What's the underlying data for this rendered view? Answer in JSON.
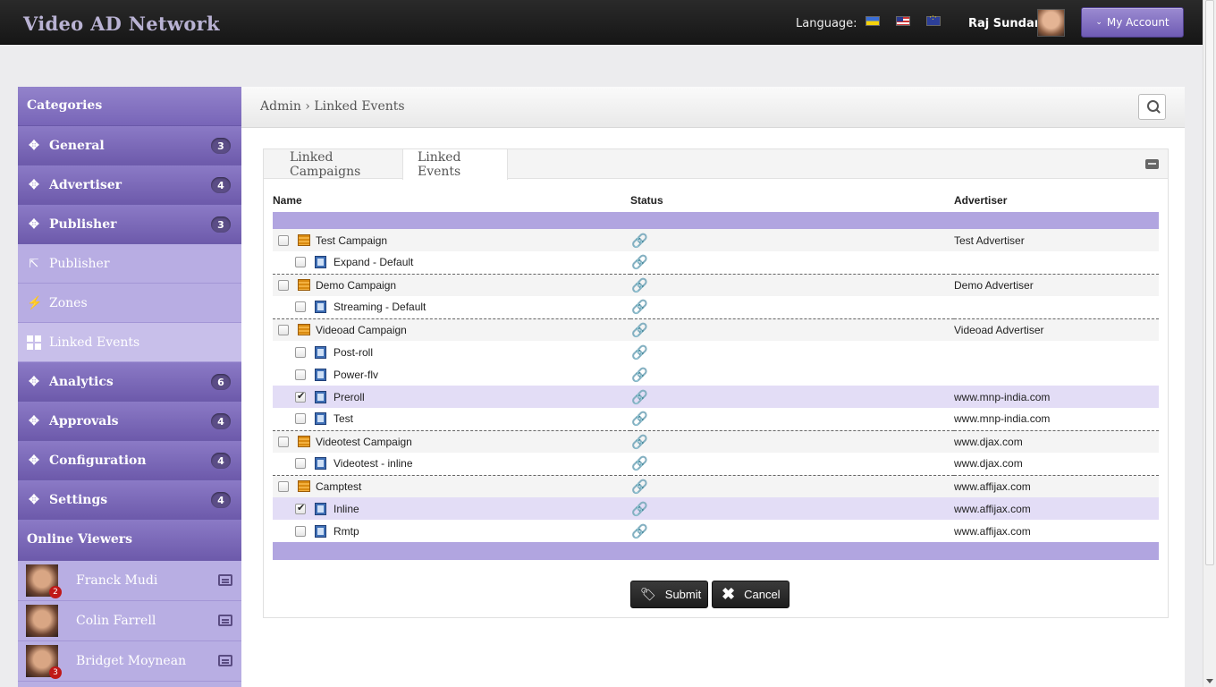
{
  "header": {
    "brand": "Video AD Network",
    "language_label": "Language:",
    "flags": [
      "ukraine-flag-icon",
      "us-flag-icon",
      "eu-flag-icon"
    ],
    "user_name": "Raj Sundar",
    "account_label": "My Account"
  },
  "sidebar": {
    "title": "Categories",
    "items": [
      {
        "label": "General",
        "icon": "move-icon",
        "badge": "3",
        "style": "dark"
      },
      {
        "label": "Advertiser",
        "icon": "move-icon",
        "badge": "4",
        "style": "dark"
      },
      {
        "label": "Publisher",
        "icon": "move-icon",
        "badge": "3",
        "style": "dark"
      },
      {
        "label": "Publisher",
        "icon": "external-link-icon",
        "badge": "",
        "style": "light"
      },
      {
        "label": "Zones",
        "icon": "lightning-icon",
        "badge": "",
        "style": "light"
      },
      {
        "label": "Linked Events",
        "icon": "grid-icon",
        "badge": "",
        "style": "active"
      },
      {
        "label": "Analytics",
        "icon": "move-icon",
        "badge": "6",
        "style": "dark"
      },
      {
        "label": "Approvals",
        "icon": "move-icon",
        "badge": "4",
        "style": "dark"
      },
      {
        "label": "Configuration",
        "icon": "move-icon",
        "badge": "4",
        "style": "dark"
      },
      {
        "label": "Settings",
        "icon": "move-icon",
        "badge": "4",
        "style": "dark"
      }
    ],
    "viewers_title": "Online Viewers",
    "viewers": [
      {
        "name": "Franck Mudi",
        "badge": "2"
      },
      {
        "name": "Colin Farrell",
        "badge": ""
      },
      {
        "name": "Bridget Moynean",
        "badge": "3"
      }
    ]
  },
  "main": {
    "breadcrumb": "Admin › Linked Events",
    "tabs": [
      "Linked Campaigns",
      "Linked Events"
    ],
    "columns": [
      "Name",
      "Status",
      "Advertiser"
    ],
    "rows": [
      {
        "type": "campaign",
        "name": "Test Campaign",
        "checked": false,
        "advertiser": "Test Advertiser"
      },
      {
        "type": "event",
        "name": "Expand - Default",
        "checked": false,
        "advertiser": "",
        "end": true
      },
      {
        "type": "campaign",
        "name": "Demo Campaign",
        "checked": false,
        "advertiser": "Demo Advertiser"
      },
      {
        "type": "event",
        "name": "Streaming - Default",
        "checked": false,
        "advertiser": "",
        "end": true
      },
      {
        "type": "campaign",
        "name": "Videoad Campaign",
        "checked": false,
        "advertiser": "Videoad Advertiser"
      },
      {
        "type": "event",
        "name": "Post-roll",
        "checked": false,
        "advertiser": ""
      },
      {
        "type": "event",
        "name": "Power-flv",
        "checked": false,
        "advertiser": ""
      },
      {
        "type": "event",
        "name": "Preroll",
        "checked": true,
        "advertiser": "www.mnp-india.com"
      },
      {
        "type": "event",
        "name": "Test",
        "checked": false,
        "advertiser": "www.mnp-india.com",
        "end": true
      },
      {
        "type": "campaign",
        "name": "Videotest Campaign",
        "checked": false,
        "advertiser": "www.djax.com"
      },
      {
        "type": "event",
        "name": "Videotest - inline",
        "checked": false,
        "advertiser": "www.djax.com",
        "end": true
      },
      {
        "type": "campaign",
        "name": "Camptest",
        "checked": false,
        "advertiser": "www.affijax.com"
      },
      {
        "type": "event",
        "name": "Inline",
        "checked": true,
        "advertiser": "www.affijax.com"
      },
      {
        "type": "event",
        "name": "Rmtp",
        "checked": false,
        "advertiser": "www.affijax.com"
      }
    ],
    "submit_label": "Submit",
    "cancel_label": "Cancel"
  }
}
